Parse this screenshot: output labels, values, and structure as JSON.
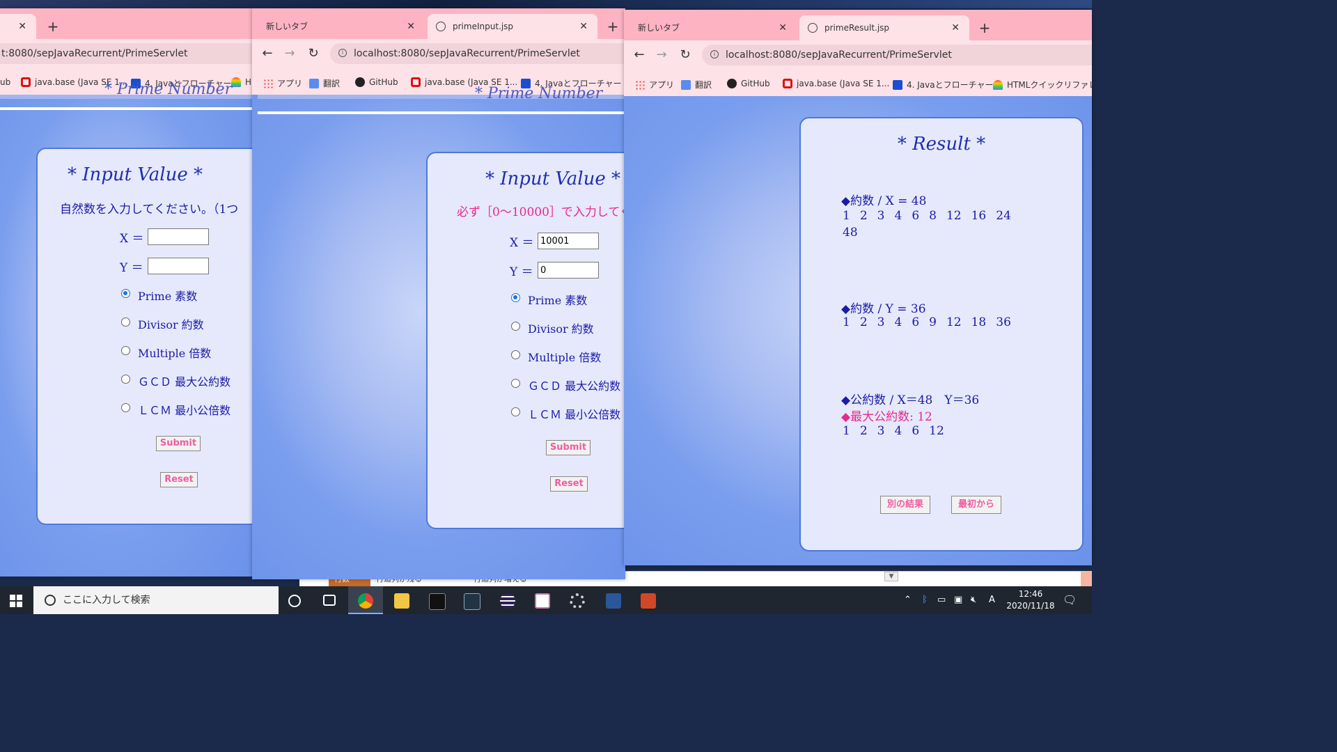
{
  "window_left": {
    "tab_close": "✕",
    "new_tab": "+",
    "url": "t:8080/sepJavaRecurrent/PrimeServlet",
    "bookmarks": [
      "ub",
      "java.base (Java SE 1...",
      "4. Javaとフローチャート",
      "H"
    ],
    "header_ghost": "* Prime Number",
    "panel_title": "* Input Value *",
    "message": "自然数を入力してください。（1つ",
    "x_label": "X ＝",
    "y_label": "Y ＝",
    "x_value": "",
    "y_value": "",
    "radios": [
      "Prime 素数",
      "Divisor 約数",
      "Multiple 倍数",
      "ＧＣＤ 最大公約数",
      "ＬＣＭ 最小公倍数"
    ],
    "submit": "Submit",
    "reset": "Reset"
  },
  "window_middle": {
    "tab_inactive": "新しいタブ",
    "tab_active": "primeInput.jsp",
    "url": "localhost:8080/sepJavaRecurrent/PrimeServlet",
    "bookmarks": [
      "アプリ",
      "翻訳",
      "GitHub",
      "java.base (Java SE 1...",
      "4. Javaとフローチャート"
    ],
    "header_ghost": "* Prime Number",
    "panel_title": "* Input Value *",
    "error_message": "必ず［0～10000］で入力してく",
    "x_label": "X ＝",
    "y_label": "Y ＝",
    "x_value": "10001",
    "y_value": "0",
    "radios": [
      "Prime 素数",
      "Divisor 約数",
      "Multiple 倍数",
      "ＧＣＤ 最大公約数",
      "ＬＣＭ 最小公倍数"
    ],
    "submit": "Submit",
    "reset": "Reset"
  },
  "window_right": {
    "tab_inactive": "新しいタブ",
    "tab_active": "primeResult.jsp",
    "url": "localhost:8080/sepJavaRecurrent/PrimeServlet",
    "bookmarks": [
      "アプリ",
      "翻訳",
      "GitHub",
      "java.base (Java SE 1...",
      "4. Javaとフローチャート",
      "HTMLクイックリファレ..."
    ],
    "panel_title": "* Result *",
    "x_divisors_heading": "◆約数 / X = 48",
    "x_divisors": [
      "1",
      "2",
      "3",
      "4",
      "6",
      "8",
      "12",
      "16",
      "24",
      "48"
    ],
    "y_divisors_heading": "◆約数 / Y = 36",
    "y_divisors": [
      "1",
      "2",
      "3",
      "4",
      "6",
      "9",
      "12",
      "18",
      "36"
    ],
    "common_heading": "◆公約数 / X＝48　Y＝36",
    "gcd_line": "◆最大公約数: 12",
    "common_divisors": [
      "1",
      "2",
      "3",
      "4",
      "6",
      "12"
    ],
    "btn_other": "別の結果",
    "btn_start": "最初から"
  },
  "desktop_strip": {
    "text1": "行数",
    "text2": "行迄列が残る",
    "text3": "行迄列が増える"
  },
  "taskbar": {
    "search_placeholder": "ここに入力して検索",
    "time": "12:46",
    "date": "2020/11/18",
    "ime": "A"
  }
}
